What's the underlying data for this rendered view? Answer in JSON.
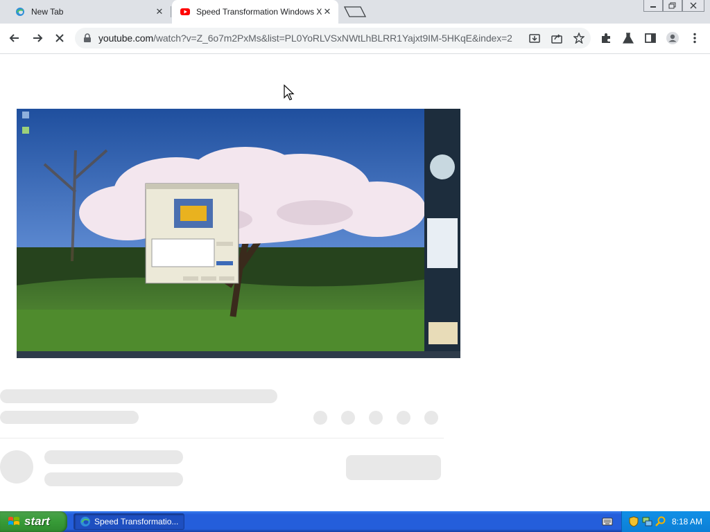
{
  "browser": {
    "tabs": [
      {
        "label": "New Tab",
        "active": false
      },
      {
        "label": "Speed Transformation Windows XP t",
        "active": true
      }
    ],
    "url_host": "youtube.com",
    "url_path": "/watch?v=Z_6o7m2PxMs&list=PL0YoRLVSxNWtLhBLRR1Yajxt9IM-5HKqE&index=2"
  },
  "taskbar": {
    "start_label": "start",
    "task_label": "Speed Transformatio...",
    "clock": "8:18 AM"
  },
  "colors": {
    "xp_taskbar": "#245edb",
    "start_green": "#379b37",
    "chrome_strip": "#dee1e6"
  }
}
